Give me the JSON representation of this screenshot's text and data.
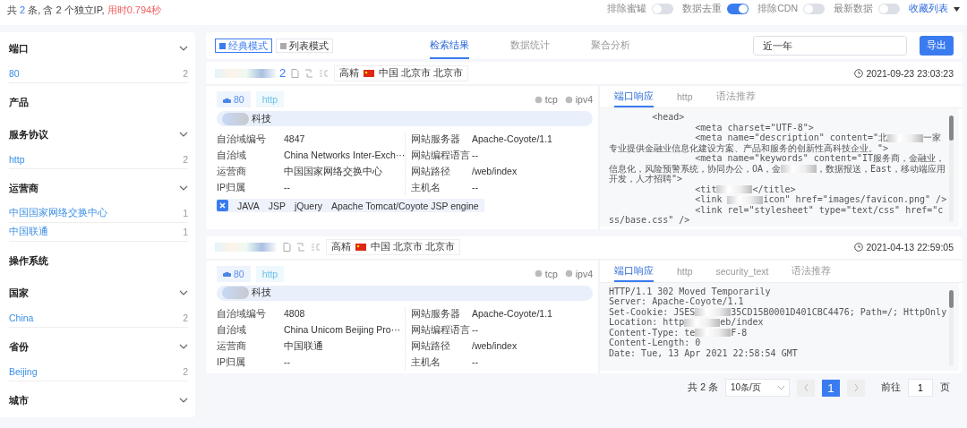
{
  "summary": [
    {
      "kind": "plain",
      "text": "共 "
    },
    {
      "kind": "count",
      "text": "2"
    },
    {
      "kind": "plain",
      "text": " 条, 含 2 个独立IP, "
    },
    {
      "kind": "time",
      "text": "用时0.794秒"
    }
  ],
  "toggles": [
    {
      "label": "排除蜜罐",
      "on": false
    },
    {
      "label": "数据去重",
      "on": true
    },
    {
      "label": "排除CDN",
      "on": false
    },
    {
      "label": "最新数据",
      "on": false
    }
  ],
  "favorites": "收藏列表",
  "sidebar": [
    {
      "title": "端口",
      "expandable": true,
      "items": [
        {
          "label": "80",
          "count": "2"
        }
      ]
    },
    {
      "title": "产品",
      "expandable": false
    },
    {
      "title": "服务协议",
      "expandable": true,
      "items": [
        {
          "label": "http",
          "count": "2"
        }
      ]
    },
    {
      "title": "运营商",
      "expandable": true,
      "items": [
        {
          "label": "中国国家网络交换中心",
          "count": "1"
        },
        {
          "label": "中国联通",
          "count": "1"
        }
      ]
    },
    {
      "title": "操作系统",
      "expandable": false
    },
    {
      "title": "国家",
      "expandable": true,
      "items": [
        {
          "label": "China",
          "count": "2"
        }
      ]
    },
    {
      "title": "省份",
      "expandable": true,
      "items": [
        {
          "label": "Beijing",
          "count": "2"
        }
      ]
    },
    {
      "title": "城市",
      "expandable": true
    }
  ],
  "view_modes": [
    {
      "label": "经典模式",
      "selected": true
    },
    {
      "label": "列表模式",
      "selected": false
    }
  ],
  "tabs": [
    {
      "label": "检索结果",
      "selected": true
    },
    {
      "label": "数据统计",
      "selected": false
    },
    {
      "label": "聚合分析",
      "selected": false
    }
  ],
  "time_range": "近一年",
  "export_button": "导出",
  "results": [
    {
      "host": "2",
      "precision": "高精",
      "location": "中国 北京市 北京市",
      "time": "2021-09-23 23:03:23",
      "port": "80",
      "protocol": "http",
      "transport": "tcp",
      "ip_version": "ipv4",
      "org": "科技",
      "info": [
        [
          "自治域编号",
          "4847",
          "网站服务器",
          "Apache-Coyote/1.1"
        ],
        [
          "自治域",
          "China Networks Inter-Exch···",
          "网站编程语言",
          "--"
        ],
        [
          "运营商",
          "中国国家网络交换中心",
          "网站路径",
          "/web/index"
        ],
        [
          "IP归属",
          "--",
          "主机名",
          "--"
        ]
      ],
      "tech": [
        "JAVA",
        "JSP",
        "jQuery",
        "Apache Tomcat/Coyote JSP engine"
      ],
      "panel_tabs": [
        {
          "label": "端口响应",
          "selected": true
        },
        {
          "label": "http",
          "selected": false
        },
        {
          "label": "语法推荐",
          "selected": false
        }
      ],
      "response": [
        [
          "        <head>"
        ],
        [
          "                <meta charset=\"UTF-8\">"
        ],
        [
          "                <meta name=\"description\" content=\"北",
          "一家专业提供金融业信息化建设方案、产品和服务的创新性高科技企业。\">"
        ],
        [
          "                <meta name=\"keywords\" content=\"IT服务商，金融业，信息化，风险预警系统，协同办公，OA，金",
          "，数据报送，East，移动端应用开发，人才招聘\">"
        ],
        [
          "                <tit",
          "</title>"
        ],
        [
          "                <link ",
          "icon\" href=\"images/favicon.png\" />"
        ],
        [
          "                <link rel=\"stylesheet\" type=\"text/css\" href=\"css/base.css\" />"
        ]
      ]
    },
    {
      "precision": "高精",
      "location": "中国 北京市 北京市",
      "time": "2021-04-13 22:59:05",
      "port": "80",
      "protocol": "http",
      "transport": "tcp",
      "ip_version": "ipv4",
      "org": "科技",
      "info": [
        [
          "自治域编号",
          "4808",
          "网站服务器",
          "Apache-Coyote/1.1"
        ],
        [
          "自治域",
          "China Unicom Beijing Pro···",
          "网站编程语言",
          "--"
        ],
        [
          "运营商",
          "中国联通",
          "网站路径",
          "/web/index"
        ],
        [
          "IP归属",
          "--",
          "主机名",
          "--"
        ]
      ],
      "panel_tabs": [
        {
          "label": "端口响应",
          "selected": true
        },
        {
          "label": "http",
          "selected": false
        },
        {
          "label": "security_text",
          "selected": false
        },
        {
          "label": "语法推荐",
          "selected": false
        }
      ],
      "response": [
        [
          "HTTP/1.1 302 Moved Temporarily"
        ],
        [
          "Server: Apache-Coyote/1.1"
        ],
        [
          "Set-Cookie: JSES",
          "35CD15B0001D401CBC4476; Path=/; HttpOnly"
        ],
        [
          "Location: http",
          "eb/index"
        ],
        [
          "Content-Type: te",
          "F-8"
        ],
        [
          "Content-Length: 0"
        ],
        [
          "Date: Tue, 13 Apr 2021 22:58:54 GMT"
        ]
      ]
    }
  ],
  "pagination": {
    "total": "共 2 条",
    "page_size": "10条/页",
    "pages": [
      {
        "label": "1",
        "selected": true
      }
    ],
    "goto_label": "前往",
    "goto_value": "1",
    "goto_suffix": "页"
  }
}
